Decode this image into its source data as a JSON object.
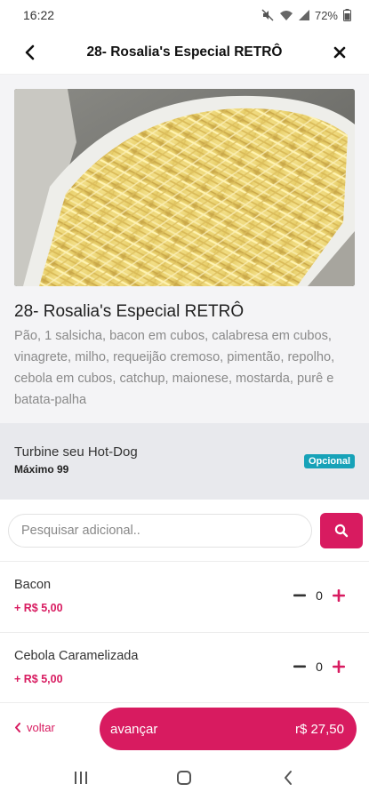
{
  "status_bar": {
    "time": "16:22",
    "battery": "72%",
    "icons": [
      "mute-icon",
      "wifi-icon",
      "signal-icon",
      "battery-icon"
    ]
  },
  "header": {
    "title": "28- Rosalia's Especial RETRÔ",
    "back_icon": "chevron-left-icon",
    "close_icon": "close-icon"
  },
  "product": {
    "image": "potato-sticks-photo",
    "name": "28- Rosalia's Especial RETRÔ",
    "description": "Pão, 1 salsicha, bacon em cubos, calabresa em cubos, vinagrete, milho, requeijão cremoso, pimentão, repolho, cebola em cubos, catchup, maionese, mostarda, purê e batata-palha"
  },
  "addon_group": {
    "title": "Turbine seu Hot-Dog",
    "subtitle": "Máximo 99",
    "badge": "Opcional"
  },
  "search": {
    "placeholder": "Pesquisar adicional..",
    "value": ""
  },
  "addons": [
    {
      "name": "Bacon",
      "price": "+ R$ 5,00",
      "quantity": "0"
    },
    {
      "name": "Cebola Caramelizada",
      "price": "+ R$ 5,00",
      "quantity": "0"
    }
  ],
  "footer": {
    "back_label": "voltar",
    "advance_label": "avançar",
    "total": "r$ 27,50"
  },
  "colors": {
    "accent": "#d81b60",
    "badge": "#17a2b8",
    "group_bg": "#e8e9ed",
    "product_bg": "#f4f4f6"
  }
}
